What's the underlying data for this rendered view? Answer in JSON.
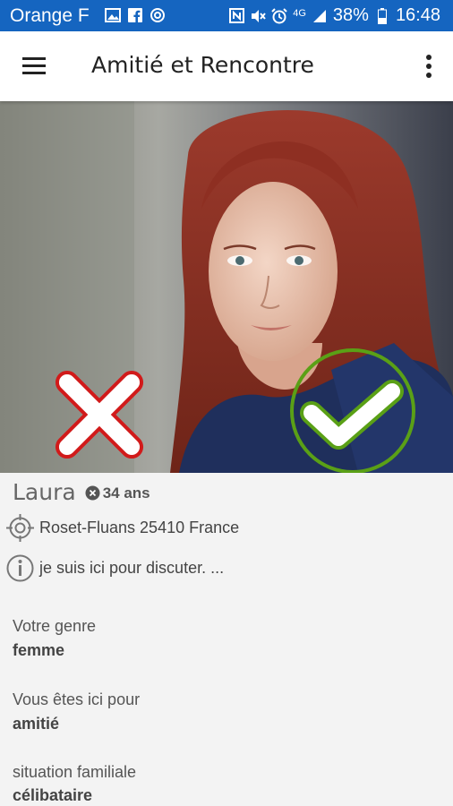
{
  "status_bar": {
    "carrier": "Orange F",
    "network": "4G",
    "battery": "38%",
    "time": "16:48",
    "icons": [
      "gallery-icon",
      "facebook-icon",
      "sync-icon",
      "nfc-icon",
      "mute-icon",
      "alarm-icon",
      "signal-icon",
      "battery-icon"
    ]
  },
  "app_bar": {
    "title": "Amitié et Rencontre",
    "menu_icon": "hamburger-menu-icon",
    "overflow_icon": "more-vert-icon"
  },
  "photo": {
    "reject_icon": "reject-x-icon",
    "accept_icon": "accept-check-icon",
    "colors": {
      "reject": "#d11a1a",
      "accept": "#5aa016"
    }
  },
  "profile": {
    "name": "Laura",
    "age": "34 ans",
    "location": "Roset-Fluans 25410 France",
    "about": "je suis ici pour discuter. ...",
    "fields": [
      {
        "label": "Votre genre",
        "value": "femme"
      },
      {
        "label": "Vous êtes ici pour",
        "value": "amitié"
      },
      {
        "label": "situation familiale",
        "value": "célibataire"
      }
    ]
  }
}
